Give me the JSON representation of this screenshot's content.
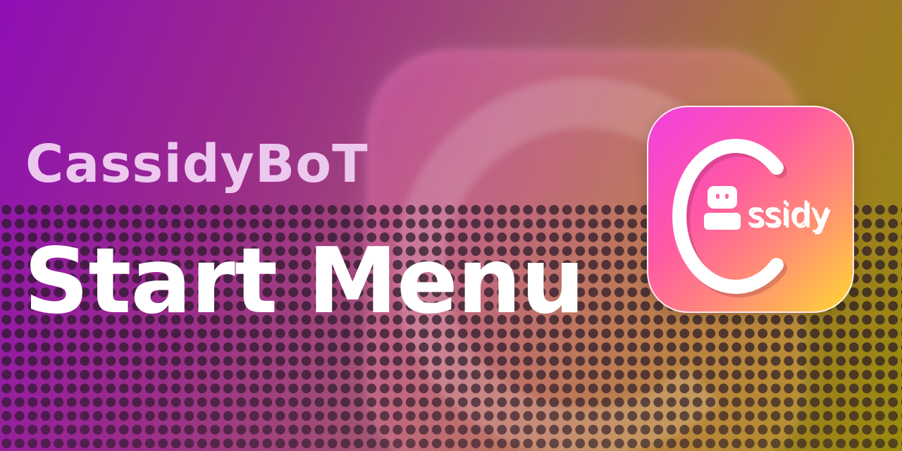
{
  "header": {
    "app_name": "CassidyBoT",
    "title": "Start Menu"
  },
  "logo": {
    "icon_name": "cassidy-app-icon",
    "wordmark": "ssidy"
  },
  "colors": {
    "background_start": "#8e0fb5",
    "background_end": "#9a8a0e",
    "icon_gradient_start": "#f03fe0",
    "icon_gradient_end": "#ffd633",
    "app_name_color": "#ecc7ee",
    "title_color": "#ffffff"
  }
}
